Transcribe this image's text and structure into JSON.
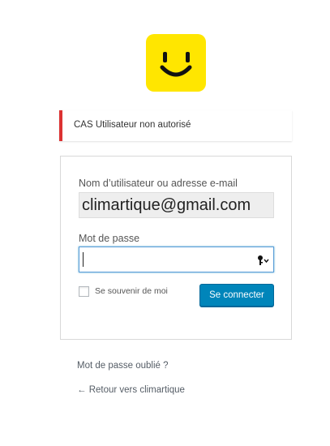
{
  "logo": {
    "icon": "smiley-face-icon",
    "background": "#ffe600"
  },
  "notice": {
    "message": "CAS Utilisateur non autorisé",
    "accent_color": "#dc3232"
  },
  "login_form": {
    "username_label": "Nom d’utilisateur ou adresse e-mail",
    "username_value": "climartique@gmail.com",
    "password_label": "Mot de passe",
    "password_value": "",
    "password_icon": "key-dropdown-icon",
    "remember_label": "Se souvenir de moi",
    "remember_checked": false,
    "submit_label": "Se connecter",
    "submit_color": "#0085ba"
  },
  "links": {
    "lost_password": "Mot de passe oublié ?",
    "back_to_site": "← Retour vers climartique"
  }
}
